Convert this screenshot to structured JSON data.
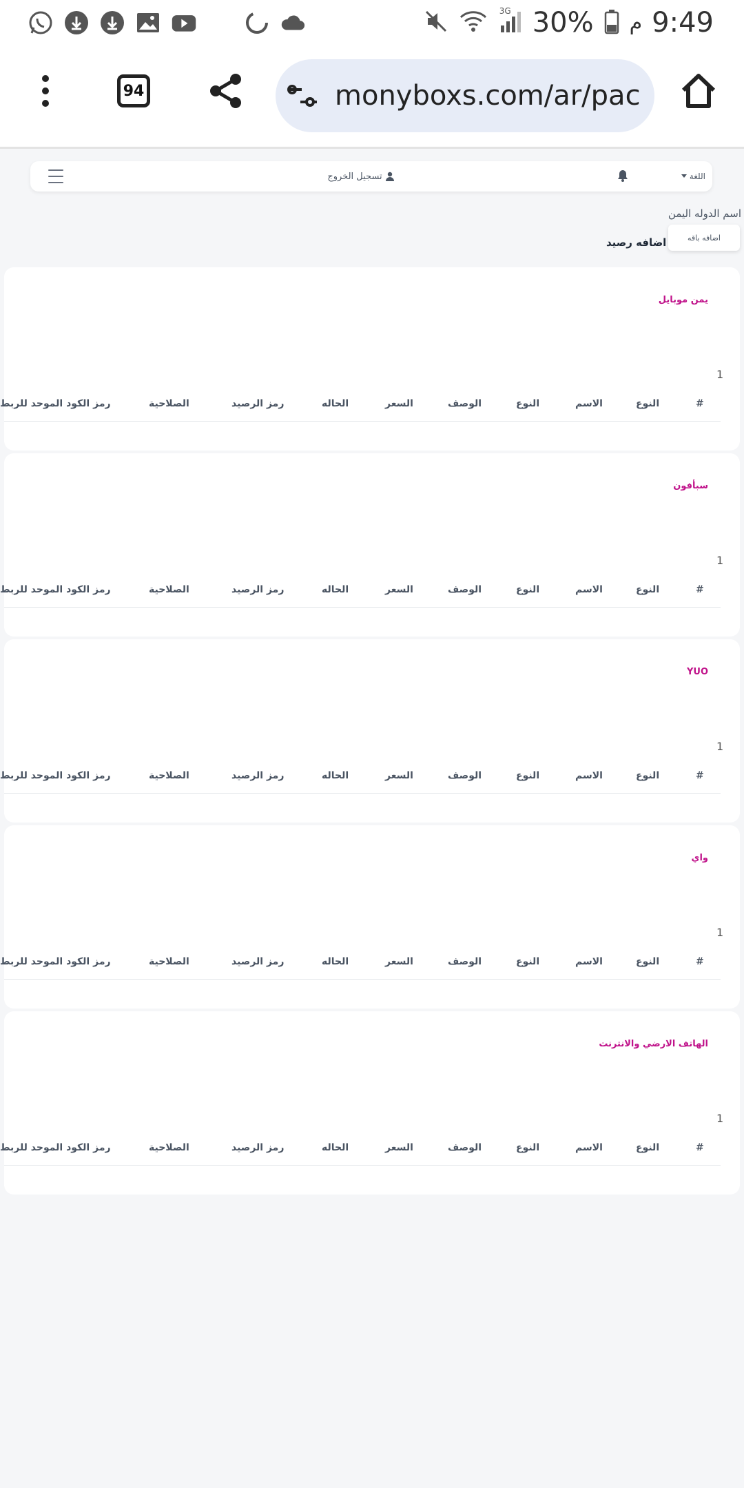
{
  "status_bar": {
    "clock": "9:49",
    "ampm": "م",
    "battery_pct": "30%",
    "network": "3G",
    "icons": [
      "whatsapp-icon",
      "download-icon",
      "download-icon",
      "image-icon",
      "youtube-icon",
      "sync-icon",
      "cloud-icon"
    ]
  },
  "browser": {
    "tab_count": "94",
    "url": "monyboxs.com/ar/pac"
  },
  "navbar": {
    "logout_label": "تسجيل الخروج",
    "language_label": "اللغة"
  },
  "page": {
    "country_label": "اسم الدوله اليمن",
    "add_package_label": "اضافه باقه",
    "add_balance_label": "اضافه رصيد"
  },
  "table_columns": [
    "#",
    "النوع",
    "الاسم",
    "النوع",
    "الوصف",
    "السعر",
    "الحاله",
    "رمز الرصيد",
    "الصلاحية",
    "رمز الكود الموحد للربط"
  ],
  "cards": [
    {
      "title": "يمن موبايل",
      "count": "1"
    },
    {
      "title": "سبأفون",
      "count": "1"
    },
    {
      "title": "YUO",
      "count": "1"
    },
    {
      "title": "واي",
      "count": "1"
    },
    {
      "title": "الهاتف الارضي والانترنت",
      "count": "1"
    }
  ]
}
